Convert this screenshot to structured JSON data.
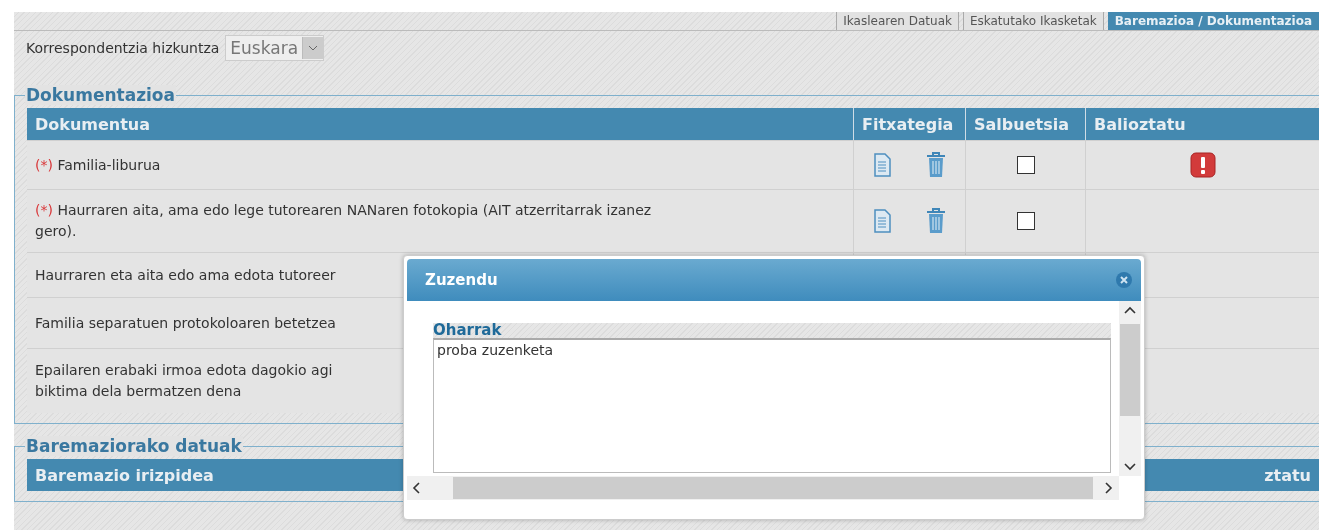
{
  "tabs": [
    {
      "label": "Ikaslearen Datuak",
      "selected": false
    },
    {
      "label": "Eskatutako Ikasketak",
      "selected": false
    },
    {
      "label": "Baremazioa / Dokumentazioa",
      "selected": true
    }
  ],
  "language": {
    "label": "Korrespondentzia hizkuntza",
    "value": "Euskara"
  },
  "documentation": {
    "title": "Dokumentazioa",
    "columns": [
      "Dokumentua",
      "Fitxategia",
      "Salbuetsia",
      "Balioztatu"
    ],
    "rows": [
      {
        "required_mark": "(*)",
        "lines": [
          "Familia-liburua"
        ],
        "has_file": true,
        "exempt": false,
        "alert": true
      },
      {
        "required_mark": "(*)",
        "lines": [
          "Haurraren aita, ama edo lege tutorearen NANaren fotokopia (AIT atzerritarrak izanez",
          "gero)."
        ],
        "has_file": true,
        "exempt": false,
        "alert": false
      },
      {
        "lines": [
          "Haurraren eta aita edo ama edota tutoreer"
        ],
        "alert": false
      },
      {
        "lines": [
          "Familia separatuen protokoloaren betetzea"
        ],
        "alert": false
      },
      {
        "lines": [
          "Epailaren erabaki irmoa edota dagokio agi",
          "biktima dela bermatzen dena"
        ],
        "alert": false
      }
    ]
  },
  "scoring": {
    "title": "Baremaziorako datuak",
    "columns": [
      "Baremazio irizpidea",
      "ztatu"
    ]
  },
  "dialog": {
    "title": "Zuzendu",
    "fieldset": "Oharrak",
    "value": "proba zuzenketa"
  }
}
